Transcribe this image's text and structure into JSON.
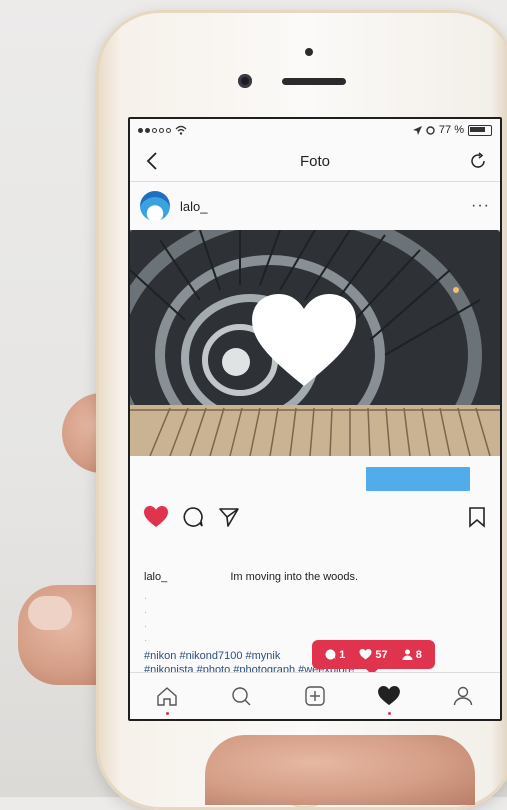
{
  "status_bar": {
    "battery": "77 %"
  },
  "nav": {
    "title": "Foto"
  },
  "post": {
    "username": "lalo_",
    "more": "···",
    "caption_user": "lalo_",
    "caption_text": "Im moving into the woods.",
    "faint_lines": [
      ".",
      ".",
      ".",
      "."
    ],
    "hashtags_line1": "#nikon #nikond7100 #mynik",
    "hashtags_line2": "#nikonista #photo #photograph #weexplore_"
  },
  "notification": {
    "comments": "1",
    "likes": "57",
    "followers": "8"
  },
  "colors": {
    "accent": "#e0344e",
    "link": "#2c4f7f",
    "blue_bar": "#3fa3e8"
  },
  "icons": [
    "back-icon",
    "refresh-icon",
    "heart-icon",
    "comment-icon",
    "share-icon",
    "bookmark-icon",
    "home-icon",
    "search-icon",
    "add-icon",
    "activity-icon",
    "profile-icon"
  ]
}
